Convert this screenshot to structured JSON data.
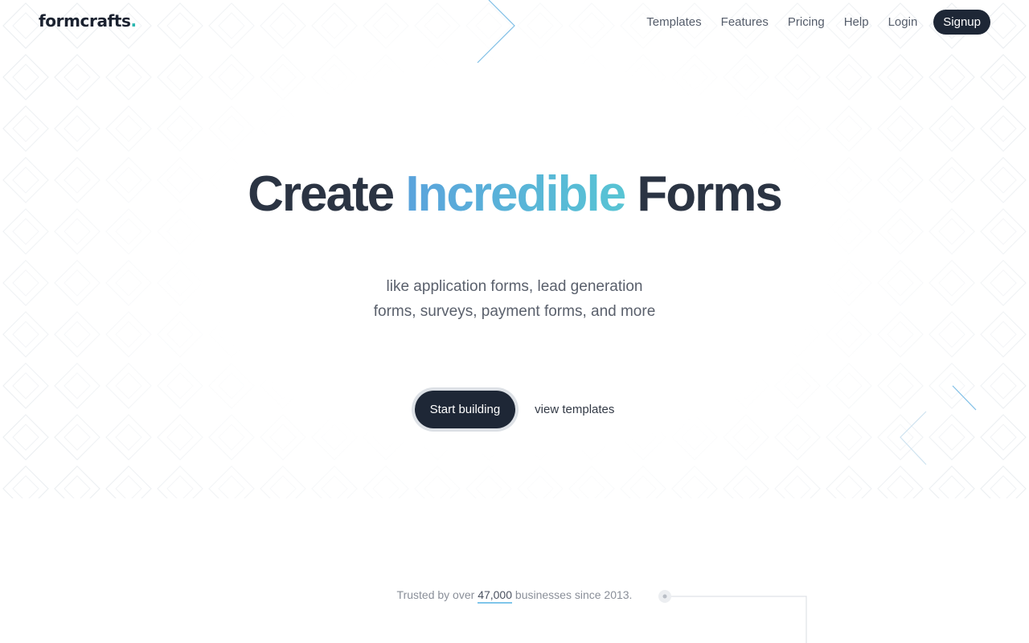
{
  "header": {
    "logo_text": "formcrafts",
    "logo_dot": ".",
    "nav": [
      {
        "label": "Templates"
      },
      {
        "label": "Features"
      },
      {
        "label": "Pricing"
      },
      {
        "label": "Help"
      },
      {
        "label": "Login"
      }
    ],
    "signup_label": "Signup"
  },
  "hero": {
    "title_before": "Create",
    "title_accent": "Incredible",
    "title_after": "Forms",
    "subtitle_line1": "like application forms, lead generation",
    "subtitle_line2": "forms, surveys, payment forms, and more",
    "primary_cta": "Start building",
    "secondary_cta": "view templates"
  },
  "trust": {
    "prefix": "Trusted by over",
    "count": "47,000",
    "suffix": "businesses since 2013."
  },
  "colors": {
    "brand_dark": "#1e2736",
    "accent_blue": "#5aa3dc",
    "accent_teal": "#2ab7b0",
    "pattern_line": "#eef1f4"
  }
}
